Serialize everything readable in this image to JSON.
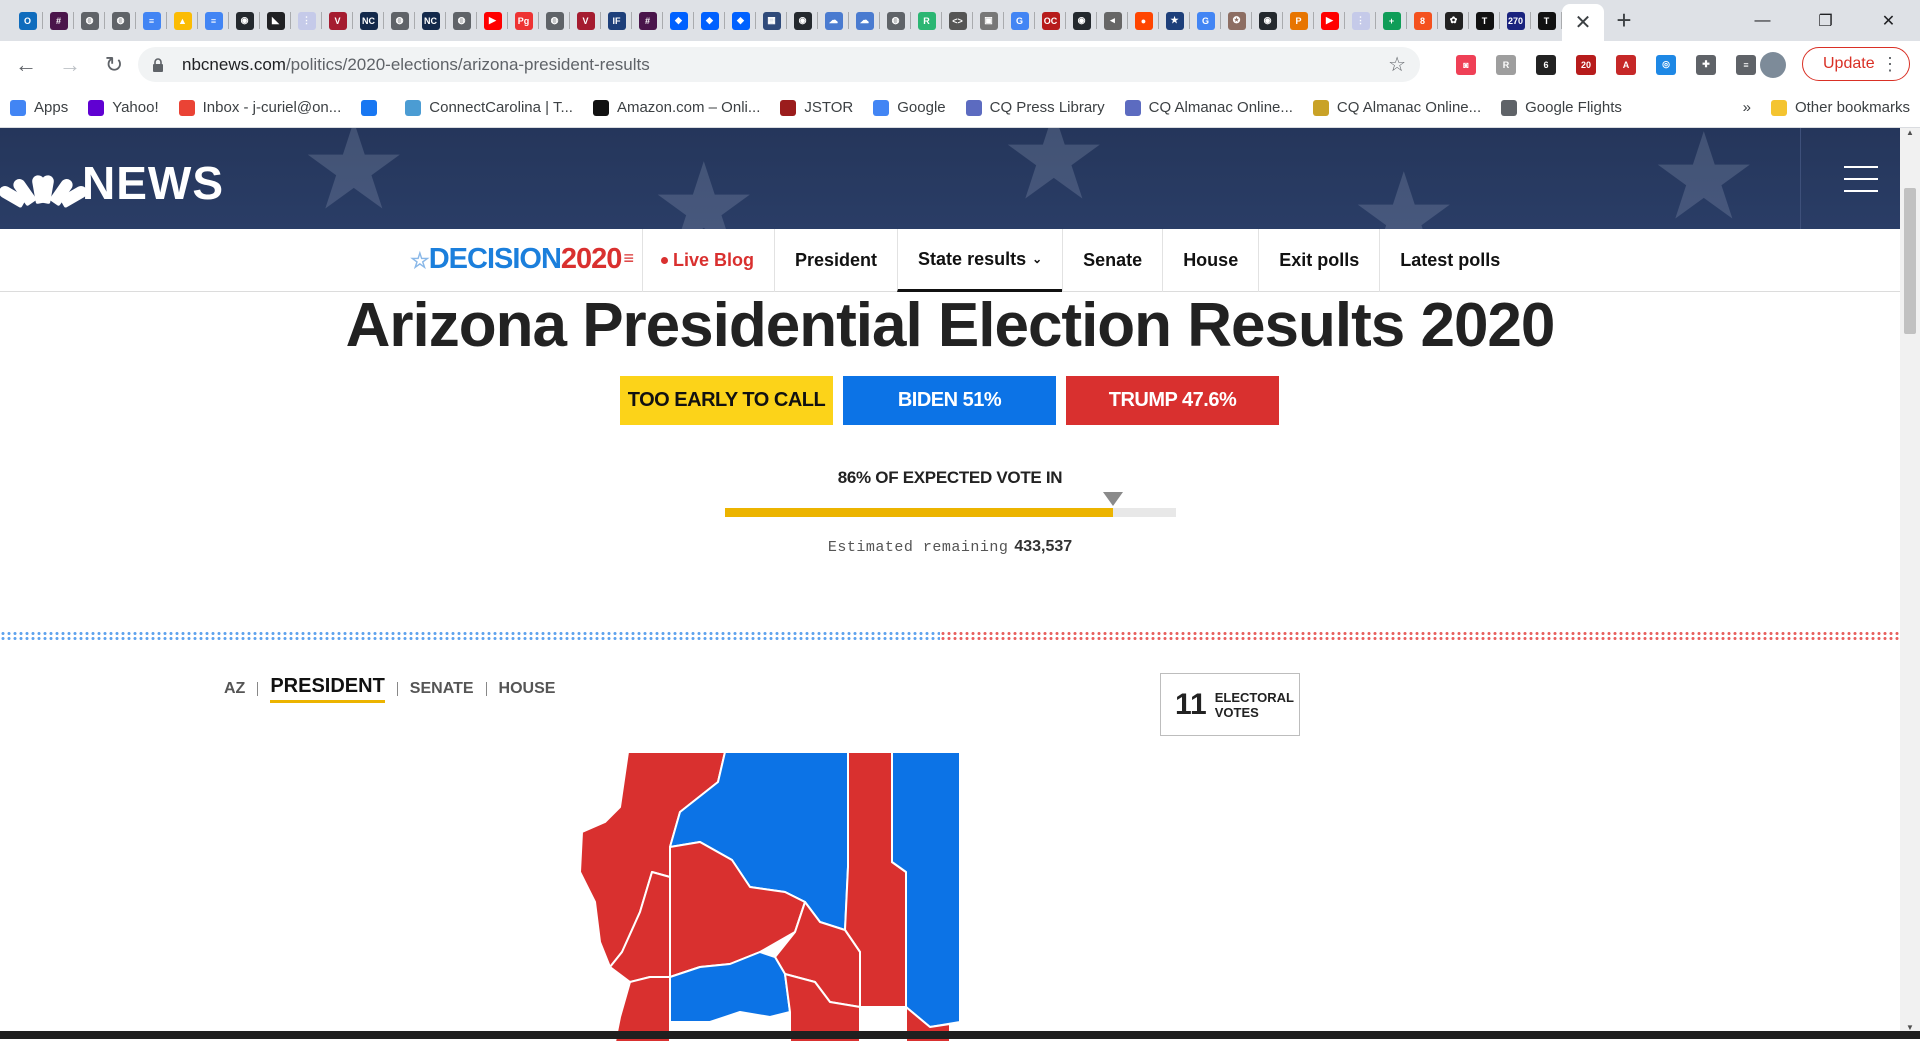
{
  "browser": {
    "tab_favicons": [
      {
        "icon": "outlook-icon",
        "color": "#0f6cbd",
        "glyph": "O"
      },
      {
        "icon": "slack-icon",
        "color": "#4a154b",
        "glyph": "#"
      },
      {
        "icon": "globe-icon",
        "color": "#5f6368",
        "glyph": "◍"
      },
      {
        "icon": "globe-icon",
        "color": "#5f6368",
        "glyph": "◍"
      },
      {
        "icon": "docs-icon",
        "color": "#4285f4",
        "glyph": "≡"
      },
      {
        "icon": "drive-icon",
        "color": "#fbbc04",
        "glyph": "▲"
      },
      {
        "icon": "docs-icon",
        "color": "#4285f4",
        "glyph": "≡"
      },
      {
        "icon": "github-icon",
        "color": "#24292e",
        "glyph": "◉"
      },
      {
        "icon": "ny-icon",
        "color": "#202124",
        "glyph": "◣"
      },
      {
        "icon": "grid-icon",
        "color": "#c5cae9",
        "glyph": "⋮"
      },
      {
        "icon": "harvard-icon",
        "color": "#a51c30",
        "glyph": "V"
      },
      {
        "icon": "nc-icon",
        "color": "#13294b",
        "glyph": "NC"
      },
      {
        "icon": "globe-icon",
        "color": "#5f6368",
        "glyph": "◍"
      },
      {
        "icon": "nc-icon",
        "color": "#13294b",
        "glyph": "NC"
      },
      {
        "icon": "globe-icon",
        "color": "#5f6368",
        "glyph": "◍"
      },
      {
        "icon": "youtube-icon",
        "color": "#ff0000",
        "glyph": "▶"
      },
      {
        "icon": "pg-icon",
        "color": "#e33",
        "glyph": "Pg"
      },
      {
        "icon": "globe-icon",
        "color": "#5f6368",
        "glyph": "◍"
      },
      {
        "icon": "harvard-icon",
        "color": "#a51c30",
        "glyph": "V"
      },
      {
        "icon": "ifes-icon",
        "color": "#1d3f7a",
        "glyph": "IF"
      },
      {
        "icon": "slack-icon",
        "color": "#4a154b",
        "glyph": "#"
      },
      {
        "icon": "dropbox-icon",
        "color": "#0061ff",
        "glyph": "◆"
      },
      {
        "icon": "dropbox-icon",
        "color": "#0061ff",
        "glyph": "◆"
      },
      {
        "icon": "dropbox-icon",
        "color": "#0061ff",
        "glyph": "◆"
      },
      {
        "icon": "bank-icon",
        "color": "#2f4a7a",
        "glyph": "▦"
      },
      {
        "icon": "github-icon",
        "color": "#24292e",
        "glyph": "◉"
      },
      {
        "icon": "cloud-icon",
        "color": "#4a7bd0",
        "glyph": "☁"
      },
      {
        "icon": "cloud-icon",
        "color": "#4a7bd0",
        "glyph": "☁"
      },
      {
        "icon": "globe-icon",
        "color": "#5f6368",
        "glyph": "◍"
      },
      {
        "icon": "r-icon",
        "color": "#2bb673",
        "glyph": "R"
      },
      {
        "icon": "code-icon",
        "color": "#555",
        "glyph": "<>"
      },
      {
        "icon": "image-icon",
        "color": "#777",
        "glyph": "▣"
      },
      {
        "icon": "google-icon",
        "color": "#4285f4",
        "glyph": "G"
      },
      {
        "icon": "ocj-icon",
        "color": "#b71c1c",
        "glyph": "OC"
      },
      {
        "icon": "github-icon",
        "color": "#24292e",
        "glyph": "◉"
      },
      {
        "icon": "audio-icon",
        "color": "#666",
        "glyph": "◂"
      },
      {
        "icon": "reddit-icon",
        "color": "#ff4500",
        "glyph": "●"
      },
      {
        "icon": "star-badge-icon",
        "color": "#1d3f7a",
        "glyph": "★"
      },
      {
        "icon": "google-icon",
        "color": "#4285f4",
        "glyph": "G"
      },
      {
        "icon": "seal-icon",
        "color": "#8d6e63",
        "glyph": "✪"
      },
      {
        "icon": "github-icon",
        "color": "#24292e",
        "glyph": "◉"
      },
      {
        "icon": "princeton-icon",
        "color": "#e77500",
        "glyph": "P"
      },
      {
        "icon": "youtube-icon",
        "color": "#ff0000",
        "glyph": "▶"
      },
      {
        "icon": "grid-icon",
        "color": "#c5cae9",
        "glyph": "⋮"
      },
      {
        "icon": "plus-box-icon",
        "color": "#0f9d58",
        "glyph": "+"
      },
      {
        "icon": "people-icon",
        "color": "#f4511e",
        "glyph": "8"
      },
      {
        "icon": "nbc-peacock-icon",
        "color": "#222",
        "glyph": "✿"
      },
      {
        "icon": "nyt-icon",
        "color": "#111",
        "glyph": "T"
      },
      {
        "icon": "270-icon",
        "color": "#1a237e",
        "glyph": "270"
      },
      {
        "icon": "nyt-icon",
        "color": "#111",
        "glyph": "T"
      }
    ],
    "active_tab_close": "✕",
    "new_tab": "+",
    "window_controls": {
      "minimize": "—",
      "maximize": "❐",
      "close": "✕"
    },
    "nav": {
      "back": "←",
      "forward": "→",
      "reload": "↻"
    },
    "url_host": "nbcnews.com",
    "url_path": "/politics/2020-elections/arizona-president-results",
    "update_label": "Update",
    "update_menu": "⋮",
    "extensions": [
      {
        "icon": "pocket-icon",
        "color": "#ef4056",
        "glyph": "◙"
      },
      {
        "icon": "reader-icon",
        "color": "#9e9e9e",
        "glyph": "R"
      },
      {
        "icon": "flame-icon",
        "color": "#222",
        "glyph": "6"
      },
      {
        "icon": "badge-icon",
        "color": "#b71c1c",
        "glyph": "20"
      },
      {
        "icon": "pdf-icon",
        "color": "#c62828",
        "glyph": "A"
      },
      {
        "icon": "translate-icon",
        "color": "#1e88e5",
        "glyph": "◎"
      },
      {
        "icon": "puzzle-icon",
        "color": "#5f6368",
        "glyph": "✚"
      },
      {
        "icon": "playlist-icon",
        "color": "#5f6368",
        "glyph": "≡"
      }
    ],
    "bookmarks": [
      {
        "icon": "apps-icon",
        "color": "#4285f4",
        "label": "Apps"
      },
      {
        "icon": "yahoo-icon",
        "color": "#6001d2",
        "label": "Yahoo!"
      },
      {
        "icon": "gmail-icon",
        "color": "#ea4335",
        "label": "Inbox - j-curiel@on..."
      },
      {
        "icon": "facebook-icon",
        "color": "#1877f2",
        "label": ""
      },
      {
        "icon": "connectcarolina-icon",
        "color": "#4b9cd3",
        "label": "ConnectCarolina | T..."
      },
      {
        "icon": "amazon-icon",
        "color": "#111",
        "label": "Amazon.com – Onli..."
      },
      {
        "icon": "jstor-icon",
        "color": "#9b1c1c",
        "label": "JSTOR"
      },
      {
        "icon": "google-icon",
        "color": "#4285f4",
        "label": "Google"
      },
      {
        "icon": "cq-icon",
        "color": "#5c6bc0",
        "label": "CQ Press Library"
      },
      {
        "icon": "cq-icon",
        "color": "#5c6bc0",
        "label": "CQ Almanac Online..."
      },
      {
        "icon": "cq-almanac-icon",
        "color": "#c9a227",
        "label": "CQ Almanac Online..."
      },
      {
        "icon": "globe-icon",
        "color": "#5f6368",
        "label": "Google Flights"
      }
    ],
    "bookmarks_overflow": "»",
    "other_bookmarks": "Other bookmarks"
  },
  "site": {
    "brand": "NEWS",
    "decision_logo": {
      "part1": "DECISION",
      "part2": "2020"
    },
    "nav_items": [
      {
        "label": "Live Blog"
      },
      {
        "label": "President"
      },
      {
        "label": "State results"
      },
      {
        "label": "Senate"
      },
      {
        "label": "House"
      },
      {
        "label": "Exit polls"
      },
      {
        "label": "Latest polls"
      }
    ]
  },
  "results": {
    "title": "Arizona Presidential Election Results 2020",
    "call_status": "TOO EARLY TO CALL",
    "biden": "BIDEN 51%",
    "trump": "TRUMP 47.6%",
    "expected_vote": "86% OF EXPECTED VOTE IN",
    "expected_fraction": 0.86,
    "remaining_label": "Estimated remaining",
    "remaining_value": "433,537",
    "colors": {
      "dem": "#0c73e6",
      "rep": "#d9302f",
      "call": "#fcd319",
      "progress": "#ecb400"
    }
  },
  "race_tabs": {
    "state": "AZ",
    "items": [
      "PRESIDENT",
      "SENATE",
      "HOUSE"
    ]
  },
  "electoral": {
    "count": "11",
    "label_line1": "ELECTORAL",
    "label_line2": "VOTES"
  }
}
